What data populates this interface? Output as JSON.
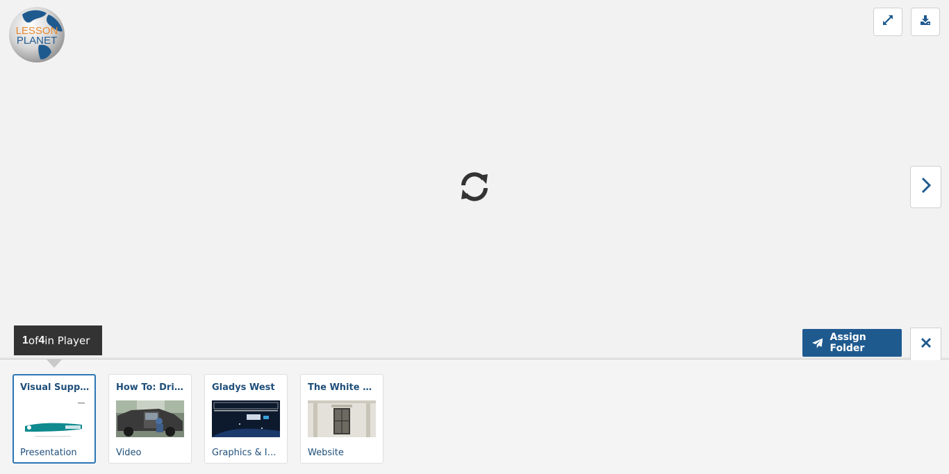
{
  "brand": {
    "logo_line1": "LESSON",
    "logo_line2": "PLANET"
  },
  "toolbar": {
    "expand_icon": "expand-icon",
    "download_icon": "download-icon"
  },
  "player": {
    "loading_icon": "refresh-icon",
    "next_icon": "chevron-right-icon"
  },
  "counter": {
    "current": "1",
    "of": " of ",
    "total": "4",
    "suffix": " in Player"
  },
  "actions": {
    "assign_label": "Assign Folder",
    "assign_icon": "paper-plane-icon",
    "close_icon": "close-icon"
  },
  "colors": {
    "accent": "#1f5a8f",
    "link": "#1f4f7a",
    "active_border": "#2b75b5"
  },
  "items": [
    {
      "title": "Visual Suppo...",
      "type": "Presentation"
    },
    {
      "title": "How To: Driv...",
      "type": "Video"
    },
    {
      "title": "Gladys West",
      "type": "Graphics & Im..."
    },
    {
      "title": "The White H...",
      "type": "Website"
    }
  ]
}
